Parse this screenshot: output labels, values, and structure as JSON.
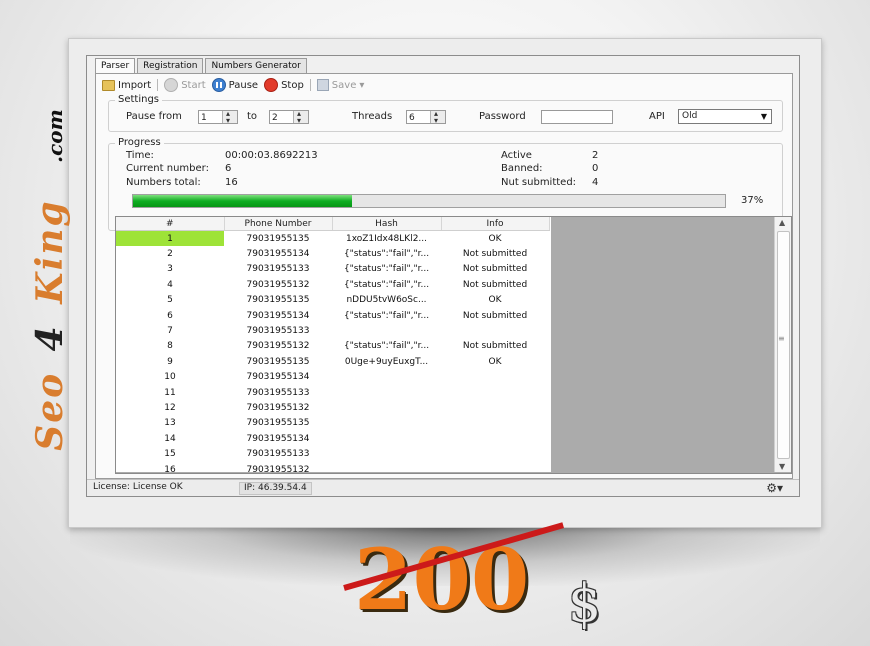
{
  "brand": {
    "part1": "Seo",
    "part2": "4",
    "part3": "King",
    "suffix": ".com"
  },
  "price": {
    "old_price": "200",
    "currency": "$"
  },
  "tabs": [
    {
      "label": "Parser",
      "active": true
    },
    {
      "label": "Registration",
      "active": false
    },
    {
      "label": "Numbers Generator",
      "active": false
    }
  ],
  "toolbar": {
    "import_label": "Import",
    "start_label": "Start",
    "pause_label": "Pause",
    "stop_label": "Stop",
    "save_label": "Save",
    "save_arrow": "▾"
  },
  "settings": {
    "title": "Settings",
    "pause_from_label": "Pause from",
    "pause_from_value": "1",
    "to_label": "to",
    "to_value": "2",
    "threads_label": "Threads",
    "threads_value": "6",
    "password_label": "Password",
    "password_value": "",
    "api_label": "API",
    "api_value": "Old"
  },
  "progress": {
    "title": "Progress",
    "time_label": "Time:",
    "time_value": "00:00:03.8692213",
    "current_label": "Current number:",
    "current_value": "6",
    "total_label": "Numbers total:",
    "total_value": "16",
    "active_label": "Active",
    "active_value": "2",
    "banned_label": "Banned:",
    "banned_value": "0",
    "not_submitted_label": "Nut submitted:",
    "not_submitted_value": "4",
    "percent": 37,
    "percent_text": "37%"
  },
  "grid": {
    "columns": [
      "#",
      "Phone Number",
      "Hash",
      "Info"
    ],
    "rows": [
      [
        "1",
        "79031955135",
        "1xoZ1Idx48LKl2...",
        "OK"
      ],
      [
        "2",
        "79031955134",
        "{\"status\":\"fail\",\"r...",
        "Not submitted"
      ],
      [
        "3",
        "79031955133",
        "{\"status\":\"fail\",\"r...",
        "Not submitted"
      ],
      [
        "4",
        "79031955132",
        "{\"status\":\"fail\",\"r...",
        "Not submitted"
      ],
      [
        "5",
        "79031955135",
        "nDDU5tvW6oSc...",
        "OK"
      ],
      [
        "6",
        "79031955134",
        "{\"status\":\"fail\",\"r...",
        "Not submitted"
      ],
      [
        "7",
        "79031955133",
        "",
        ""
      ],
      [
        "8",
        "79031955132",
        "{\"status\":\"fail\",\"r...",
        "Not submitted"
      ],
      [
        "9",
        "79031955135",
        "0Uge+9uyEuxgT...",
        "OK"
      ],
      [
        "10",
        "79031955134",
        "",
        ""
      ],
      [
        "11",
        "79031955133",
        "",
        ""
      ],
      [
        "12",
        "79031955132",
        "",
        ""
      ],
      [
        "13",
        "79031955135",
        "",
        ""
      ],
      [
        "14",
        "79031955134",
        "",
        ""
      ],
      [
        "15",
        "79031955133",
        "",
        ""
      ],
      [
        "16",
        "79031955132",
        "",
        ""
      ]
    ],
    "selected_row": 0
  },
  "status": {
    "license_label": "License:",
    "license_value": "License OK",
    "ip_label": "IP:",
    "ip_value": "46.39.54.4"
  },
  "colors": {
    "progress_green": "#0fae22",
    "selected_row": "#9ee338",
    "price_orange": "#f07a18",
    "brand_orange": "#d97d2e",
    "strike_red": "#cc1a1a"
  }
}
